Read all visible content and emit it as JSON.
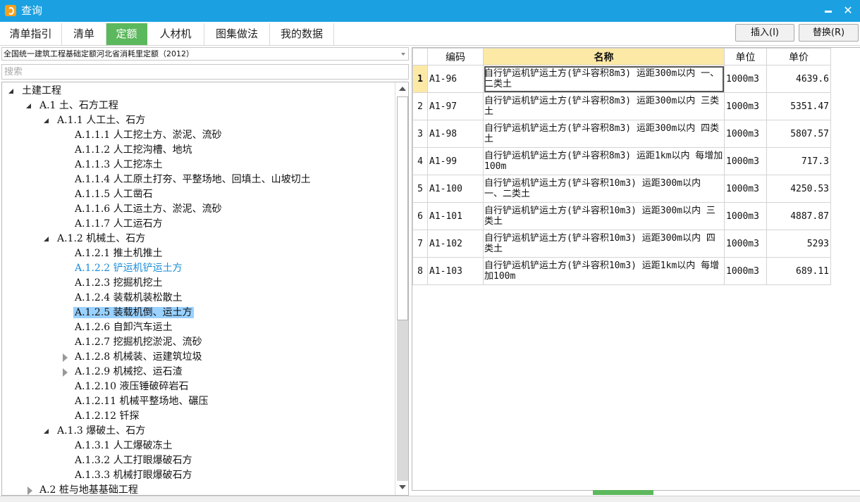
{
  "window": {
    "title": "查询",
    "minimize_icon": "minimize-icon",
    "close_label": "✕"
  },
  "tabs": [
    {
      "label": "清单指引"
    },
    {
      "label": "清单"
    },
    {
      "label": "定额"
    },
    {
      "label": "人材机"
    },
    {
      "label": "图集做法"
    },
    {
      "label": "我的数据"
    }
  ],
  "active_tab": "定额",
  "actions": {
    "insert_label": "插入(I)",
    "replace_label": "替换(R)"
  },
  "quota_library": "全国统一建筑工程基础定额河北省消耗里定额（2012）",
  "search": {
    "placeholder": "搜索",
    "value": ""
  },
  "tree": [
    {
      "label": "土建工程",
      "state": "expanded"
    },
    {
      "label": "A.1 土、石方工程",
      "state": "expanded"
    },
    {
      "label": "A.1.1 人工土、石方",
      "state": "expanded"
    },
    {
      "label": "A.1.1.1 人工挖土方、淤泥、流砂"
    },
    {
      "label": "A.1.1.2 人工挖沟槽、地坑"
    },
    {
      "label": "A.1.1.3 人工挖冻土"
    },
    {
      "label": "A.1.1.4 人工原土打夯、平整场地、回填土、山坡切土"
    },
    {
      "label": "A.1.1.5 人工凿石"
    },
    {
      "label": "A.1.1.6 人工运土方、淤泥、流砂"
    },
    {
      "label": "A.1.1.7 人工运石方"
    },
    {
      "label": "A.1.2 机械土、石方",
      "state": "expanded"
    },
    {
      "label": "A.1.2.1 推土机推土"
    },
    {
      "label": "A.1.2.2 铲运机铲运土方",
      "style": "link"
    },
    {
      "label": "A.1.2.3 挖掘机挖土"
    },
    {
      "label": "A.1.2.4 装载机装松散土"
    },
    {
      "label": "A.1.2.5 装载机倒、运土方",
      "style": "selected"
    },
    {
      "label": "A.1.2.6 自卸汽车运土"
    },
    {
      "label": "A.1.2.7 挖掘机挖淤泥、流砂"
    },
    {
      "label": "A.1.2.8 机械装、运建筑垃圾",
      "state": "collapsed"
    },
    {
      "label": "A.1.2.9 机械挖、运石渣",
      "state": "collapsed"
    },
    {
      "label": "A.1.2.10 液压锤破碎岩石"
    },
    {
      "label": "A.1.2.11 机械平整场地、碾压"
    },
    {
      "label": "A.1.2.12 钎探"
    },
    {
      "label": "A.1.3 爆破土、石方",
      "state": "expanded"
    },
    {
      "label": "A.1.3.1 人工爆破冻土"
    },
    {
      "label": "A.1.3.2 人工打眼爆破石方"
    },
    {
      "label": "A.1.3.3 机械打眼爆破石方"
    },
    {
      "label": "A.2 桩与地基基础工程",
      "state": "collapsed"
    }
  ],
  "grid": {
    "columns": [
      "编码",
      "名称",
      "单位",
      "单价"
    ],
    "rows": [
      {
        "n": "1",
        "code": "A1-96",
        "name": "自行铲运机铲运土方(铲斗容积8m3) 运距300m以内 一、二类土",
        "unit": "1000m3",
        "price": "4639.6"
      },
      {
        "n": "2",
        "code": "A1-97",
        "name": "自行铲运机铲运土方(铲斗容积8m3) 运距300m以内 三类土",
        "unit": "1000m3",
        "price": "5351.47"
      },
      {
        "n": "3",
        "code": "A1-98",
        "name": "自行铲运机铲运土方(铲斗容积8m3) 运距300m以内 四类土",
        "unit": "1000m3",
        "price": "5807.57"
      },
      {
        "n": "4",
        "code": "A1-99",
        "name": "自行铲运机铲运土方(铲斗容积8m3) 运距1km以内 每增加100m",
        "unit": "1000m3",
        "price": "717.3"
      },
      {
        "n": "5",
        "code": "A1-100",
        "name": "自行铲运机铲运土方(铲斗容积10m3) 运距300m以内 一、二类土",
        "unit": "1000m3",
        "price": "4250.53"
      },
      {
        "n": "6",
        "code": "A1-101",
        "name": "自行铲运机铲运土方(铲斗容积10m3) 运距300m以内 三类土",
        "unit": "1000m3",
        "price": "4887.87"
      },
      {
        "n": "7",
        "code": "A1-102",
        "name": "自行铲运机铲运土方(铲斗容积10m3) 运距300m以内 四类土",
        "unit": "1000m3",
        "price": "5293"
      },
      {
        "n": "8",
        "code": "A1-103",
        "name": "自行铲运机铲运土方(铲斗容积10m3) 运距1km以内 每增加100m",
        "unit": "1000m3",
        "price": "689.11"
      }
    ]
  },
  "colors": {
    "titlebar": "#1ba1e2",
    "active_tab": "#5cb85c",
    "selection": "#99d1ff",
    "link": "#1a8cd8",
    "header_highlight": "#fde9a6"
  }
}
